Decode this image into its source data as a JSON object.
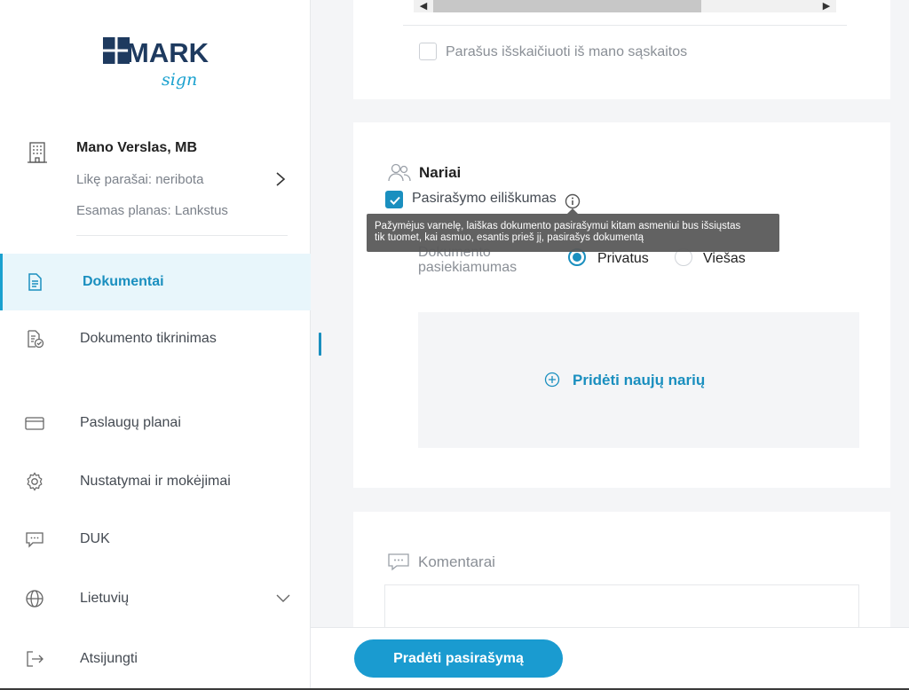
{
  "brand": {
    "logo_main": "MARK",
    "logo_sub": "sign",
    "colors": {
      "accent": "#1a8fbf",
      "primary_button": "#1a9bd0",
      "logo_dark": "#1e3a5f"
    }
  },
  "account": {
    "name": "Mano Verslas, MB",
    "signatures": "Likę parašai: neribota",
    "plan": "Esamas planas: Lankstus",
    "icon": "building-icon"
  },
  "nav": {
    "documents": "Dokumentai",
    "verification": "Dokumento tikrinimas",
    "plans": "Paslaugų planai",
    "settings": "Nustatymai ir mokėjimai",
    "faq": "DUK",
    "language": "Lietuvių",
    "logout": "Atsijungti"
  },
  "signatures_section": {
    "deduct_label": "Parašus išskaičiuoti iš mano sąskaitos",
    "deduct_checked": false
  },
  "members": {
    "title": "Nariai",
    "sequence_label": "Pasirašymo eiliškumas",
    "sequence_checked": true,
    "tooltip_line1": "Pažymėjus varnelę, laiškas dokumento pasirašymui kitam asmeniui  bus išsiųstas",
    "tooltip_line2": " tik tuomet, kai asmuo, esantis prieš jį, pasirašys dokumentą",
    "accessibility_line1": "Dokumento",
    "accessibility_line2": "pasiekiamumas",
    "option_private": "Privatus",
    "option_public": "Viešas",
    "selected": "Privatus",
    "add_member": "Pridėti naujų narių"
  },
  "comments": {
    "title": "Komentarai"
  },
  "footer": {
    "start_button": "Pradėti pasirašymą"
  }
}
